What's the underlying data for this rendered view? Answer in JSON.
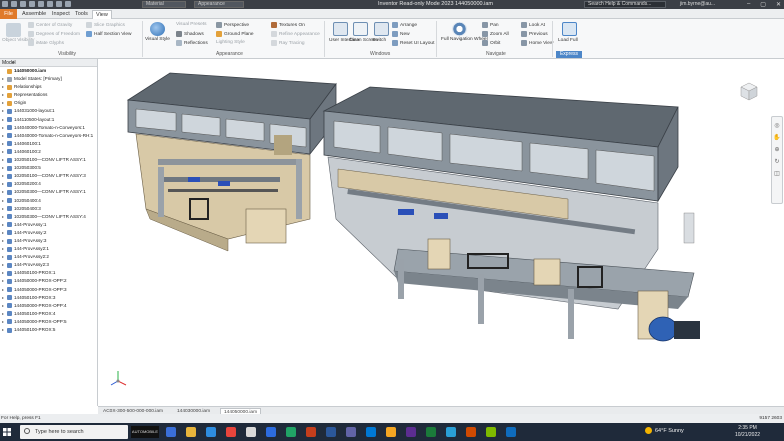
{
  "titlebar": {
    "material": "Material",
    "appearance": "Appearance",
    "title": "Inventor Read-only Mode 2023   144050000.iam",
    "search_placeholder": "Search Help & Commands...",
    "user": "jim.byrne@au..."
  },
  "tabs": [
    "File",
    "Assemble",
    "Inspect",
    "Tools",
    "View"
  ],
  "active_tab": "View",
  "ribbon": {
    "visibility": {
      "object_visibility": "Object Visibility",
      "center_of_gravity": "Center of Gravity",
      "degrees_of_freedom": "Degrees of Freedom",
      "iMate_glyphs": "iMate Glyphs",
      "slice_graphics": "Slice Graphics",
      "half_section_view": "Half Section View",
      "label": "Visibility"
    },
    "appearance": {
      "visual_style": "Visual Style",
      "visual_presets": "Visual Presets",
      "shadows": "Shadows",
      "reflections": "Reflections",
      "perspective": "Perspective",
      "ground_plane": "Ground Plane",
      "lighting_style": "Lighting Style",
      "textures_on": "Textures On",
      "refine_appearance": "Refine Appearance",
      "ray_tracing": "Ray Tracing",
      "label": "Appearance"
    },
    "windows": {
      "user_interface": "User Interface",
      "clean_screen": "Clean Screen",
      "switch": "Switch",
      "arrange": "Arrange",
      "new": "New",
      "reset_ui_layout": "Reset UI Layout",
      "label": "Windows"
    },
    "navigate": {
      "full_navigation_wheel": "Full Navigation Wheel",
      "pan": "Pan",
      "zoom_all": "Zoom All",
      "orbit": "Orbit",
      "look_at": "Look At",
      "previous": "Previous",
      "home_view": "Home View",
      "label": "Navigate"
    },
    "express": {
      "load_full": "Load Full",
      "label": "Express"
    }
  },
  "browser": {
    "header": "Model",
    "items": [
      "144050000.iam",
      "Model States: [Primary]",
      "Relationships",
      "Representations",
      "Origin",
      "144031000-layout:1",
      "144110500-layout:1",
      "144040000-Tomato-n-Conveyors:1",
      "144040000-Tomato-n-Conveyors-RH:1",
      "144060100:1",
      "144060100:2",
      "102050100—CONV LIFTR ASSY:1",
      "102050300:5",
      "102050100—CONV LIFTR ASSY:3",
      "102050200:4",
      "102050300—CONV LIFTR ASSY:1",
      "102050400:4",
      "102050400:3",
      "102050300—CONV LIFTR ASSY:4",
      "144-ProvAssy:1",
      "144-ProvAssy:2",
      "144-ProvAssy:3",
      "144-ProvAssy2:1",
      "144-ProvAssy2:2",
      "144-ProvAssy2:3",
      "144050100-PROX:1",
      "144050000-PROX-OPP:2",
      "144050000-PROX-OPP:3",
      "144050100-PROX:3",
      "144050000-PROX-OPP:4",
      "144050100-PROX:4",
      "144050000-PROX-OPP:5",
      "144050100-PROX:5"
    ]
  },
  "doc_tabs": [
    "AC0X-300-500-000-000.iam",
    "144030000.iam",
    "144050000.iam"
  ],
  "active_doc_tab": "144050000.iam",
  "status": {
    "help": "For Help, press F1",
    "nums": "9157    2603"
  },
  "taskbar": {
    "search_placeholder": "Type here to search",
    "logo": "AUTOMOBILE",
    "weather": "64°F  Sunny",
    "time": "2:35 PM",
    "date": "10/21/2022"
  }
}
